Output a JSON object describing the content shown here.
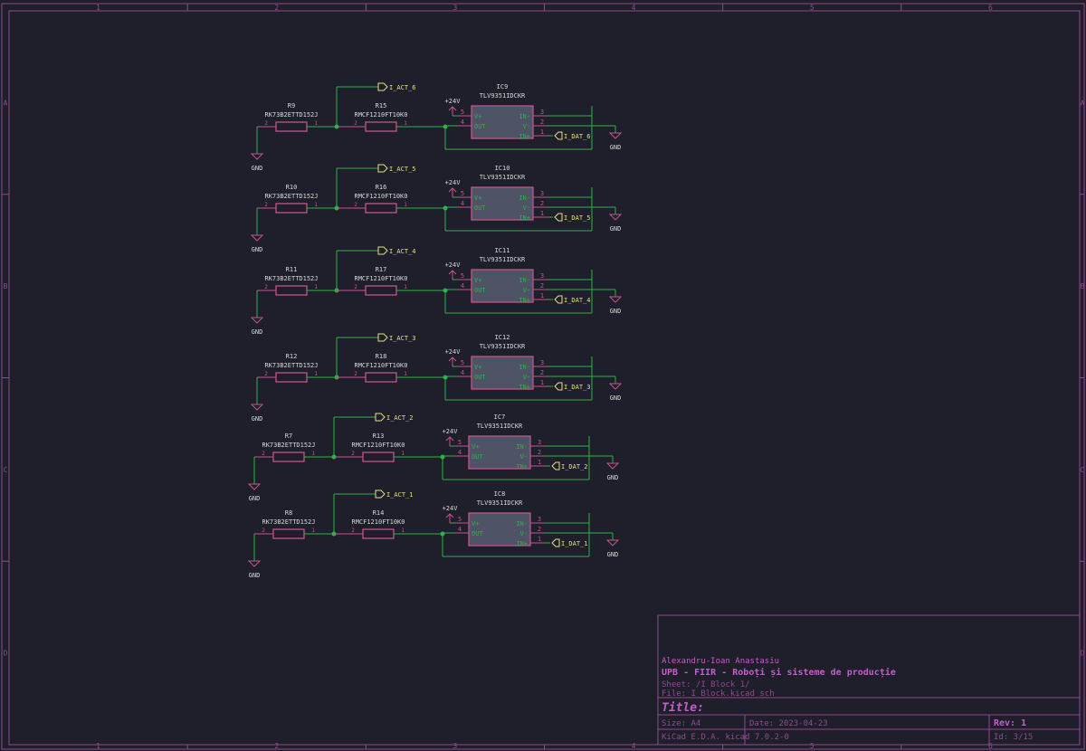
{
  "frame": {
    "columns": [
      "1",
      "2",
      "3",
      "4",
      "5",
      "6"
    ],
    "rows": [
      "A",
      "B",
      "C",
      "D"
    ]
  },
  "colors": {
    "background": "#1e1f2b",
    "frame": "#8f4a8f",
    "wire": "#2db24a",
    "component": "#c0558c",
    "body": "#4e5366",
    "text": "#d8d8d8",
    "pin": "#2db24a",
    "label": "#e6e080",
    "title_text": "#c25fc6"
  },
  "circuits": [
    {
      "res_a": "R9",
      "res_a_value": "RK73B2ETTD152J",
      "res_b": "R15",
      "res_b_value": "RMCF1210FT10K0",
      "ic": "IC9",
      "ic_value": "TLV9351IDCKR",
      "act": "I_ACT_6",
      "dat": "I_DAT_6"
    },
    {
      "res_a": "R10",
      "res_a_value": "RK73B2ETTD152J",
      "res_b": "R16",
      "res_b_value": "RMCF1210FT10K0",
      "ic": "IC10",
      "ic_value": "TLV9351IDCKR",
      "act": "I_ACT_5",
      "dat": "I_DAT_5"
    },
    {
      "res_a": "R11",
      "res_a_value": "RK73B2ETTD152J",
      "res_b": "R17",
      "res_b_value": "RMCF1210FT10K0",
      "ic": "IC11",
      "ic_value": "TLV9351IDCKR",
      "act": "I_ACT_4",
      "dat": "I_DAT_4"
    },
    {
      "res_a": "R12",
      "res_a_value": "RK73B2ETTD152J",
      "res_b": "R18",
      "res_b_value": "RMCF1210FT10K0",
      "ic": "IC12",
      "ic_value": "TLV9351IDCKR",
      "act": "I_ACT_3",
      "dat": "I_DAT_3"
    },
    {
      "res_a": "R7",
      "res_a_value": "RK73B2ETTD152J",
      "res_b": "R13",
      "res_b_value": "RMCF1210FT10K0",
      "ic": "IC7",
      "ic_value": "TLV9351IDCKR",
      "act": "I_ACT_2",
      "dat": "I_DAT_2"
    },
    {
      "res_a": "R8",
      "res_a_value": "RK73B2ETTD152J",
      "res_b": "R14",
      "res_b_value": "RMCF1210FT10K0",
      "ic": "IC8",
      "ic_value": "TLV9351IDCKR",
      "act": "I_ACT_1",
      "dat": "I_DAT_1"
    }
  ],
  "symbols": {
    "gnd": "GND",
    "supply": "+24V",
    "pin_v_plus": "V+",
    "pin_out": "OUT",
    "pin_in_minus": "IN-",
    "pin_v_minus": "V-",
    "pin_in_plus": "IN+",
    "pin_1": "1",
    "pin_2": "2",
    "pin_3": "3",
    "pin_4": "4",
    "pin_5": "5"
  },
  "title_block": {
    "author": "Alexandru-Ioan Anastasiu",
    "company": "UPB - FIIR - Roboți și sisteme de producție",
    "sheet": "Sheet: /I Block 1/",
    "file": "File: I_Block.kicad_sch",
    "title_label": "Title:",
    "size": "Size: A4",
    "date": "Date: 2023-04-23",
    "rev": "Rev: 1",
    "tool": "KiCad E.D.A.  kicad 7.0.2-0",
    "id": "Id: 3/15"
  }
}
